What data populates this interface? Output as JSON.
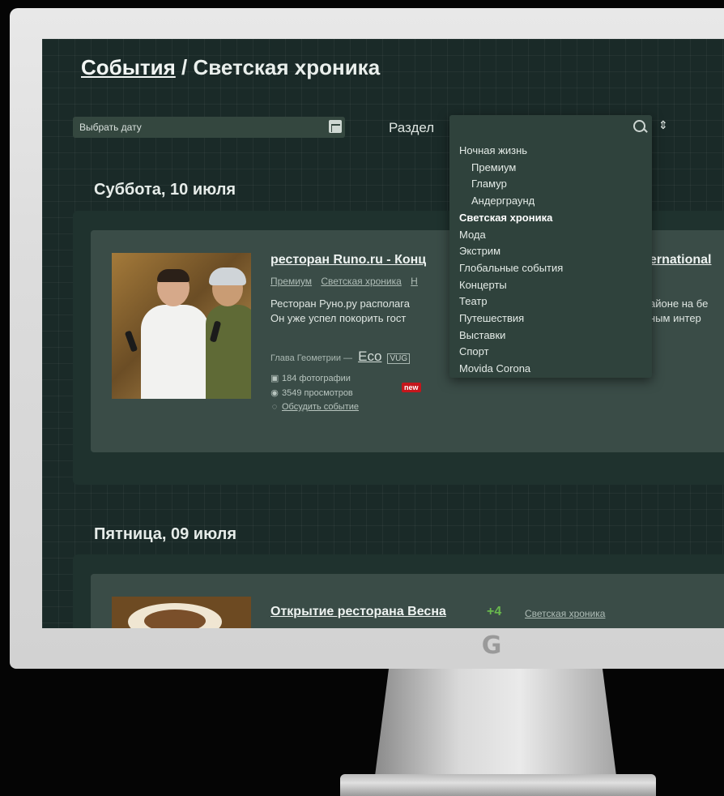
{
  "breadcrumb": {
    "root": "События",
    "separator": "/",
    "current": "Светская хроника"
  },
  "filters": {
    "date_placeholder": "Выбрать дату",
    "section_label": "Раздел",
    "section_options": [
      {
        "label": "Ночная жизнь",
        "level": 0
      },
      {
        "label": "Премиум",
        "level": 1
      },
      {
        "label": "Гламур",
        "level": 1
      },
      {
        "label": "Андерграунд",
        "level": 1
      },
      {
        "label": "Светская хроника",
        "level": 0,
        "selected": true
      },
      {
        "label": "Мода",
        "level": 0
      },
      {
        "label": "Экстрим",
        "level": 0
      },
      {
        "label": "Глобальные события",
        "level": 0
      },
      {
        "label": "Концерты",
        "level": 0
      },
      {
        "label": "Театр",
        "level": 0
      },
      {
        "label": "Путешествия",
        "level": 0
      },
      {
        "label": "Выставки",
        "level": 0
      },
      {
        "label": "Спорт",
        "level": 0
      },
      {
        "label": "Movida Corona",
        "level": 0
      }
    ]
  },
  "days": [
    {
      "heading": "Суббота, 10 июля",
      "event": {
        "title": "ресторан Runo.ru - Конц",
        "title_tail": "ernational",
        "tags": [
          "Премиум",
          "Светская хроника",
          "Н"
        ],
        "description_lines": [
          "Ресторан Руно.ру располага",
          "Он уже успел покорить гост"
        ],
        "description_tail_lines": [
          "айоне на бе",
          "ным интер"
        ],
        "sponsor_text": "Глава Геометрии —",
        "sponsor_eco": "Eco",
        "sponsor_brand": "VUG",
        "photos": "184 фотографии",
        "new_badge": "new",
        "views": "3549 просмотров",
        "discuss": "Обсудить событие"
      }
    },
    {
      "heading": "Пятница, 09 июля",
      "event": {
        "title": "Открытие ресторана Весна",
        "plus": "+4",
        "tag": "Светская хроника"
      }
    }
  ],
  "icons": {
    "calendar": "calendar-icon",
    "search": "search-icon",
    "sort": "updown-icon",
    "photo": "camera-icon",
    "views": "eye-icon",
    "comment": "comment-icon",
    "logo": "monitor-logo-icon"
  },
  "colors": {
    "background": "#1a2a28",
    "panel": "#1f322e",
    "card": "#3a4c47",
    "badge": "#c4161c",
    "plus": "#69b94d"
  }
}
